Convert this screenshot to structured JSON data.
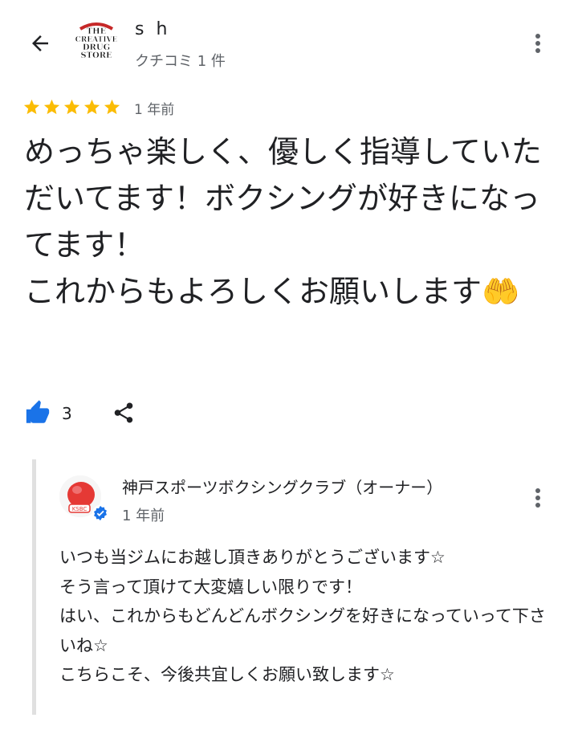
{
  "review": {
    "user_name": "s h",
    "review_count": "クチコミ 1 件",
    "avatar_logo": "THE CREATIVE DRUG STORE",
    "rating": 5,
    "time": "1 年前",
    "text": "めっちゃ楽しく、優しく指導していただいてます！ボクシングが好きになってます！\nこれからもよろしくお願いします🤲",
    "like_count": "3",
    "colors": {
      "star": "#fbbc04",
      "like": "#1a73e8",
      "verified": "#1a73e8"
    }
  },
  "owner_reply": {
    "name": "神戸スポーツボクシングクラブ（オーナー）",
    "time": "1 年前",
    "avatar_label": "KSBC",
    "text": "いつも当ジムにお越し頂きありがとうございます☆\nそう言って頂けて大変嬉しい限りです！\nはい、これからもどんどんボクシングを好きになっていって下さいね☆\nこちらこそ、今後共宜しくお願い致します☆"
  }
}
